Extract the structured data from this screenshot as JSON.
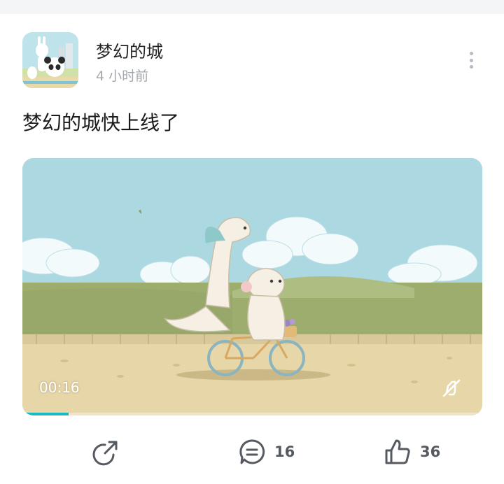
{
  "post": {
    "author": "梦幻的城",
    "time": "4 小时前",
    "title": "梦幻的城快上线了"
  },
  "video": {
    "timestamp": "00:16",
    "progress": 0.1,
    "muted": true
  },
  "actions": {
    "share_icon": "share-icon",
    "comment_icon": "comment-icon",
    "comment_count": "16",
    "like_icon": "thumbs-up-icon",
    "like_count": "36"
  },
  "colors": {
    "accent": "#19b9c4",
    "icon": "#555a61",
    "muted_text": "#a4a8ae"
  }
}
